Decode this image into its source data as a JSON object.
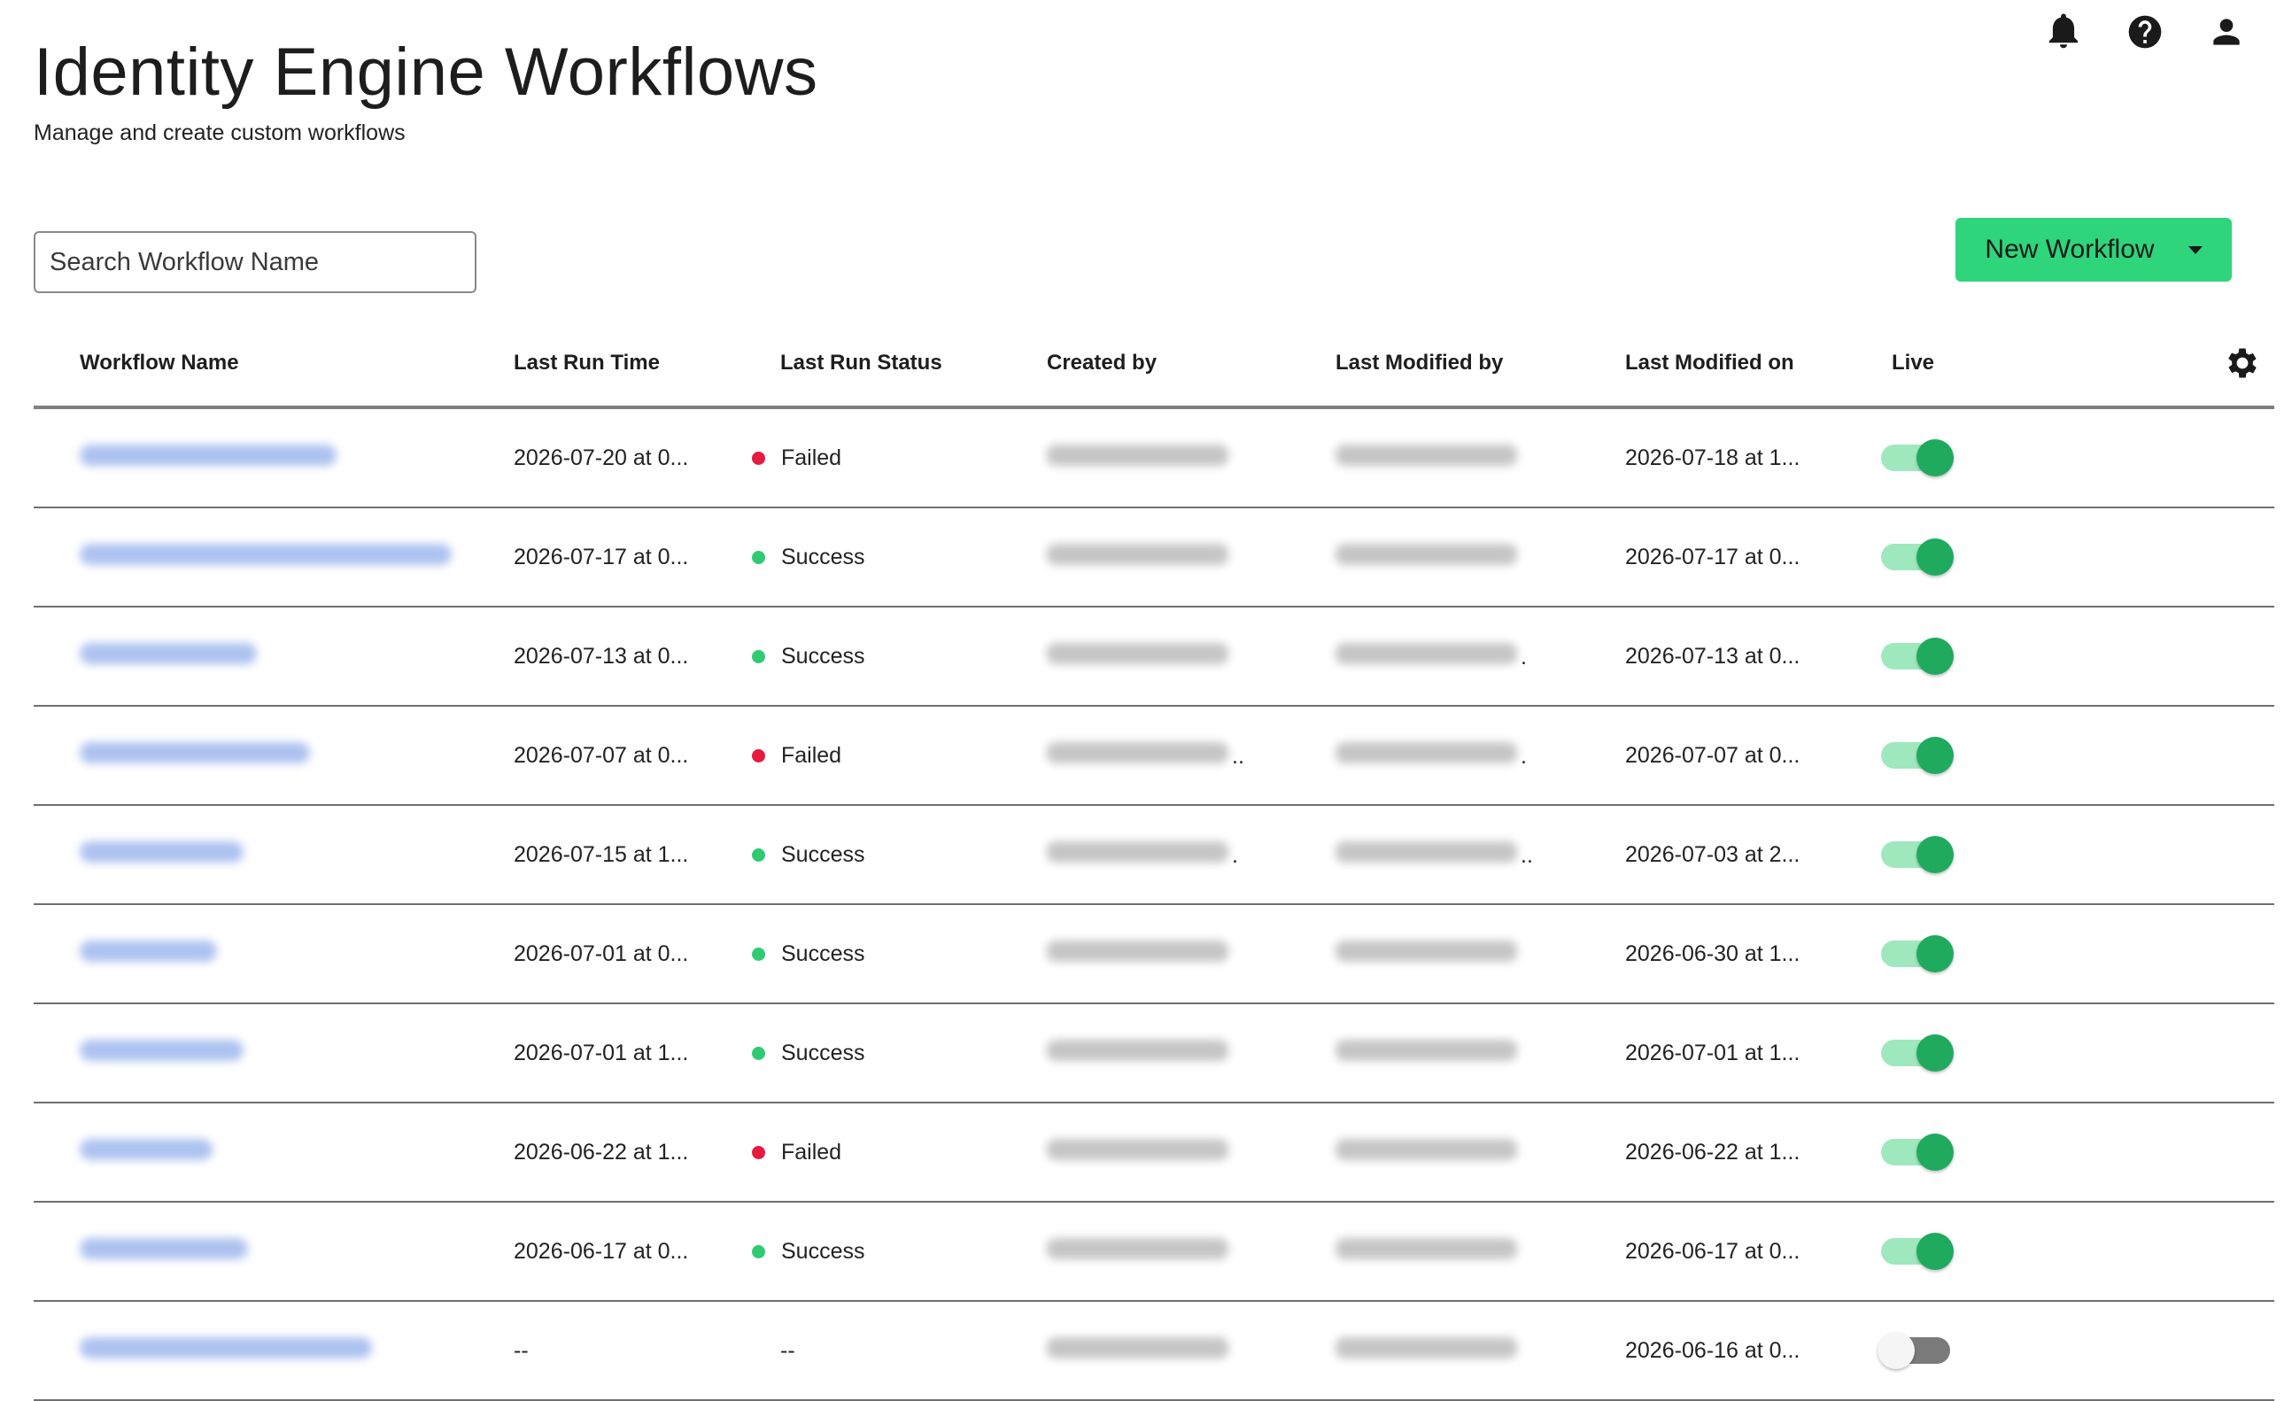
{
  "header": {
    "title": "Identity Engine Workflows",
    "subtitle": "Manage and create custom workflows"
  },
  "top_icons": [
    "bell-icon",
    "help-icon",
    "user-icon"
  ],
  "search": {
    "placeholder": "Search Workflow Name"
  },
  "new_workflow_button": {
    "label": "New Workflow"
  },
  "colors": {
    "accent": "#2ed57a",
    "failed": "#e8193f",
    "success": "#2fcb73",
    "toggle_on": "#1faa5e"
  },
  "table": {
    "columns": [
      "Workflow Name",
      "Last Run Time",
      "Last Run Status",
      "Created by",
      "Last Modified by",
      "Last Modified on",
      "Live"
    ],
    "rows": [
      {
        "last_run_time": "2026-07-20 at 0...",
        "status": "Failed",
        "status_kind": "failed",
        "created_suffix": "",
        "modified_suffix": "",
        "last_modified_on": "2026-07-18 at 1...",
        "live": true
      },
      {
        "last_run_time": "2026-07-17 at 0...",
        "status": "Success",
        "status_kind": "success",
        "created_suffix": "",
        "modified_suffix": "",
        "last_modified_on": "2026-07-17 at 0...",
        "live": true
      },
      {
        "last_run_time": "2026-07-13 at 0...",
        "status": "Success",
        "status_kind": "success",
        "created_suffix": "",
        "modified_suffix": ".",
        "last_modified_on": "2026-07-13 at 0...",
        "live": true
      },
      {
        "last_run_time": "2026-07-07 at 0...",
        "status": "Failed",
        "status_kind": "failed",
        "created_suffix": "..",
        "modified_suffix": ".",
        "last_modified_on": "2026-07-07 at 0...",
        "live": true
      },
      {
        "last_run_time": "2026-07-15 at 1...",
        "status": "Success",
        "status_kind": "success",
        "created_suffix": ".",
        "modified_suffix": "..",
        "last_modified_on": "2026-07-03 at 2...",
        "live": true
      },
      {
        "last_run_time": "2026-07-01 at 0...",
        "status": "Success",
        "status_kind": "success",
        "created_suffix": "",
        "modified_suffix": "",
        "last_modified_on": "2026-06-30 at 1...",
        "live": true
      },
      {
        "last_run_time": "2026-07-01 at 1...",
        "status": "Success",
        "status_kind": "success",
        "created_suffix": "",
        "modified_suffix": "",
        "last_modified_on": "2026-07-01 at 1...",
        "live": true
      },
      {
        "last_run_time": "2026-06-22 at 1...",
        "status": "Failed",
        "status_kind": "failed",
        "created_suffix": "",
        "modified_suffix": "",
        "last_modified_on": "2026-06-22 at 1...",
        "live": true
      },
      {
        "last_run_time": "2026-06-17 at 0...",
        "status": "Success",
        "status_kind": "success",
        "created_suffix": "",
        "modified_suffix": "",
        "last_modified_on": "2026-06-17 at 0...",
        "live": true
      },
      {
        "last_run_time": "--",
        "status": "--",
        "status_kind": "none",
        "created_suffix": "",
        "modified_suffix": "",
        "last_modified_on": "2026-06-16 at 0...",
        "live": false
      }
    ]
  }
}
